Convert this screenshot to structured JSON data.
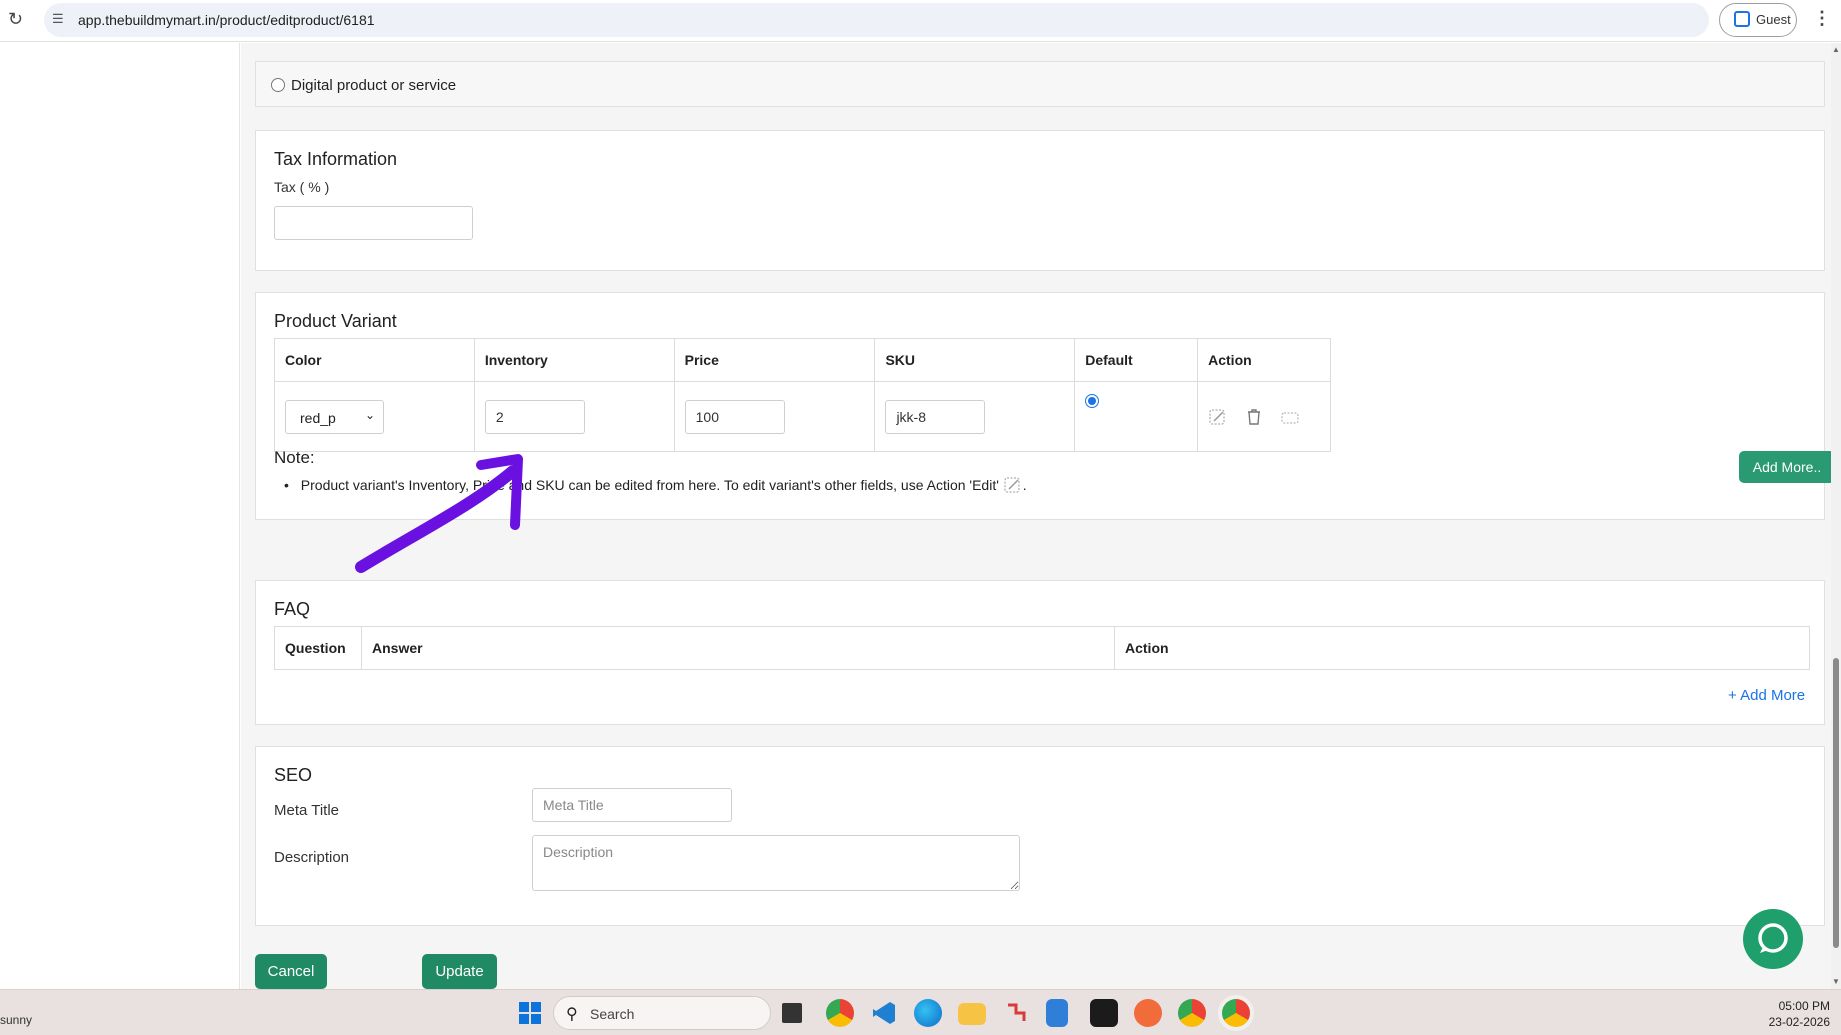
{
  "browser": {
    "url": "app.thebuildmymart.in/product/editproduct/6181",
    "guest_label": "Guest"
  },
  "product_type": {
    "digital_label": "Digital product or service"
  },
  "tax": {
    "title": "Tax Information",
    "label": "Tax ( % )",
    "value": ""
  },
  "variant": {
    "title": "Product Variant",
    "headers": [
      "Color",
      "Inventory",
      "Price",
      "SKU",
      "Default",
      "Action"
    ],
    "row": {
      "color": "red_p",
      "inventory": "2",
      "price": "100",
      "sku": "jkk-8",
      "default": true
    },
    "note_title": "Note:",
    "note_text": "Product variant's Inventory, Price and SKU can be edited from here. To edit variant's other fields, use Action 'Edit'",
    "note_suffix": ".",
    "add_more_label": "Add More.."
  },
  "faq": {
    "title": "FAQ",
    "headers": [
      "Question",
      "Answer",
      "Action"
    ],
    "add_more_label": "+ Add More"
  },
  "seo": {
    "title": "SEO",
    "meta_title_label": "Meta Title",
    "meta_title_placeholder": "Meta Title",
    "description_label": "Description",
    "description_placeholder": "Description"
  },
  "buttons": {
    "cancel": "Cancel",
    "update": "Update"
  },
  "taskbar": {
    "weather_text": "sunny",
    "search_label": "Search",
    "time": "05:00 PM",
    "date": "23-02-2026"
  },
  "colors": {
    "primary_green": "#1f8a64",
    "annotation_purple": "#6a10e0",
    "link_blue": "#1a73e8"
  }
}
